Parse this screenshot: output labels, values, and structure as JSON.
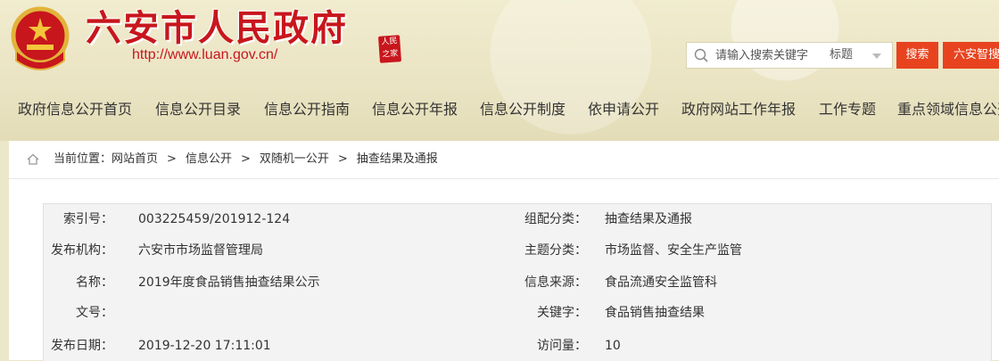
{
  "header": {
    "site_title": "六安市人民政府",
    "site_url": "http://www.luan.gov.cn/",
    "seal_text": "人民 之家",
    "search": {
      "placeholder": "请输入搜索关键字",
      "scope": "标题",
      "search_button": "搜索",
      "smart_button": "六安智搜"
    }
  },
  "nav": {
    "items": [
      "政府信息公开首页",
      "信息公开目录",
      "信息公开指南",
      "信息公开年报",
      "信息公开制度",
      "依申请公开",
      "政府网站工作年报",
      "工作专题",
      "重点领域信息公开"
    ]
  },
  "breadcrumb": {
    "prefix": "当前位置：",
    "items": [
      "网站首页",
      "信息公开",
      "双随机一公开",
      "抽查结果及通报"
    ],
    "separator": ">"
  },
  "meta": {
    "index_label": "索引号：",
    "index_value": "003225459/201912-124",
    "category_label": "组配分类：",
    "category_value": "抽查结果及通报",
    "publisher_label": "发布机构：",
    "publisher_value": "六安市市场监督管理局",
    "topic_label": "主题分类：",
    "topic_value": "市场监督、安全生产监管",
    "name_label": "名称：",
    "name_value": "2019年度食品销售抽查结果公示",
    "source_label": "信息来源：",
    "source_value": "食品流通安全监管科",
    "docno_label": "文号：",
    "docno_value": "",
    "keyword_label": "关键字：",
    "keyword_value": "食品销售抽查结果",
    "date_label": "发布日期：",
    "date_value": "2019-12-20 17:11:01",
    "views_label": "访问量：",
    "views_value": "10"
  },
  "colors": {
    "brand_red": "#c8161d",
    "button_orange": "#e8431f",
    "banner_bg": "#ece7c9"
  },
  "icons": [
    "national-emblem-icon",
    "search-icon",
    "chevron-down-icon",
    "home-icon"
  ]
}
